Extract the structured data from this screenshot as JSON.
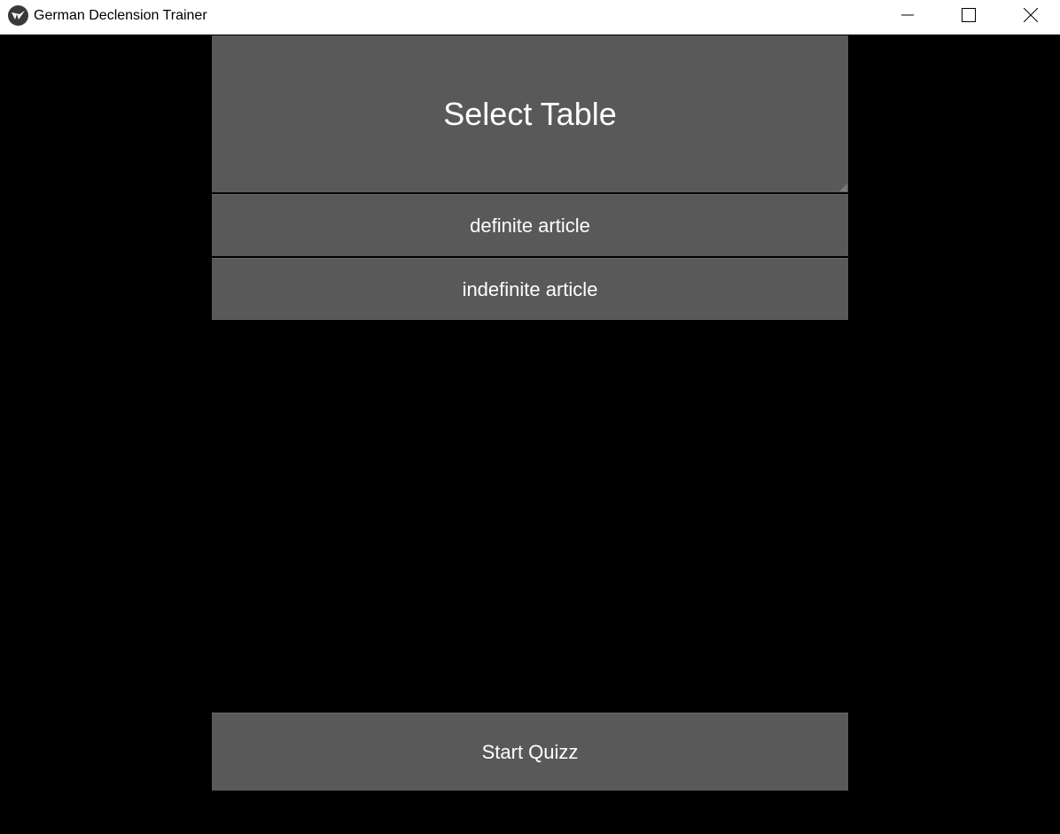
{
  "window": {
    "title": "German Declension Trainer",
    "icon": "kivy-icon",
    "controls": [
      "minimize-icon",
      "maximize-icon",
      "close-icon"
    ]
  },
  "spinner": {
    "label": "Select Table",
    "options": [
      {
        "label": "definite article"
      },
      {
        "label": "indefinite article"
      }
    ]
  },
  "start_button": {
    "label": "Start Quizz"
  },
  "colors": {
    "background": "#000000",
    "button": "#595959",
    "text": "#ffffff",
    "titlebar": "#ffffff"
  }
}
